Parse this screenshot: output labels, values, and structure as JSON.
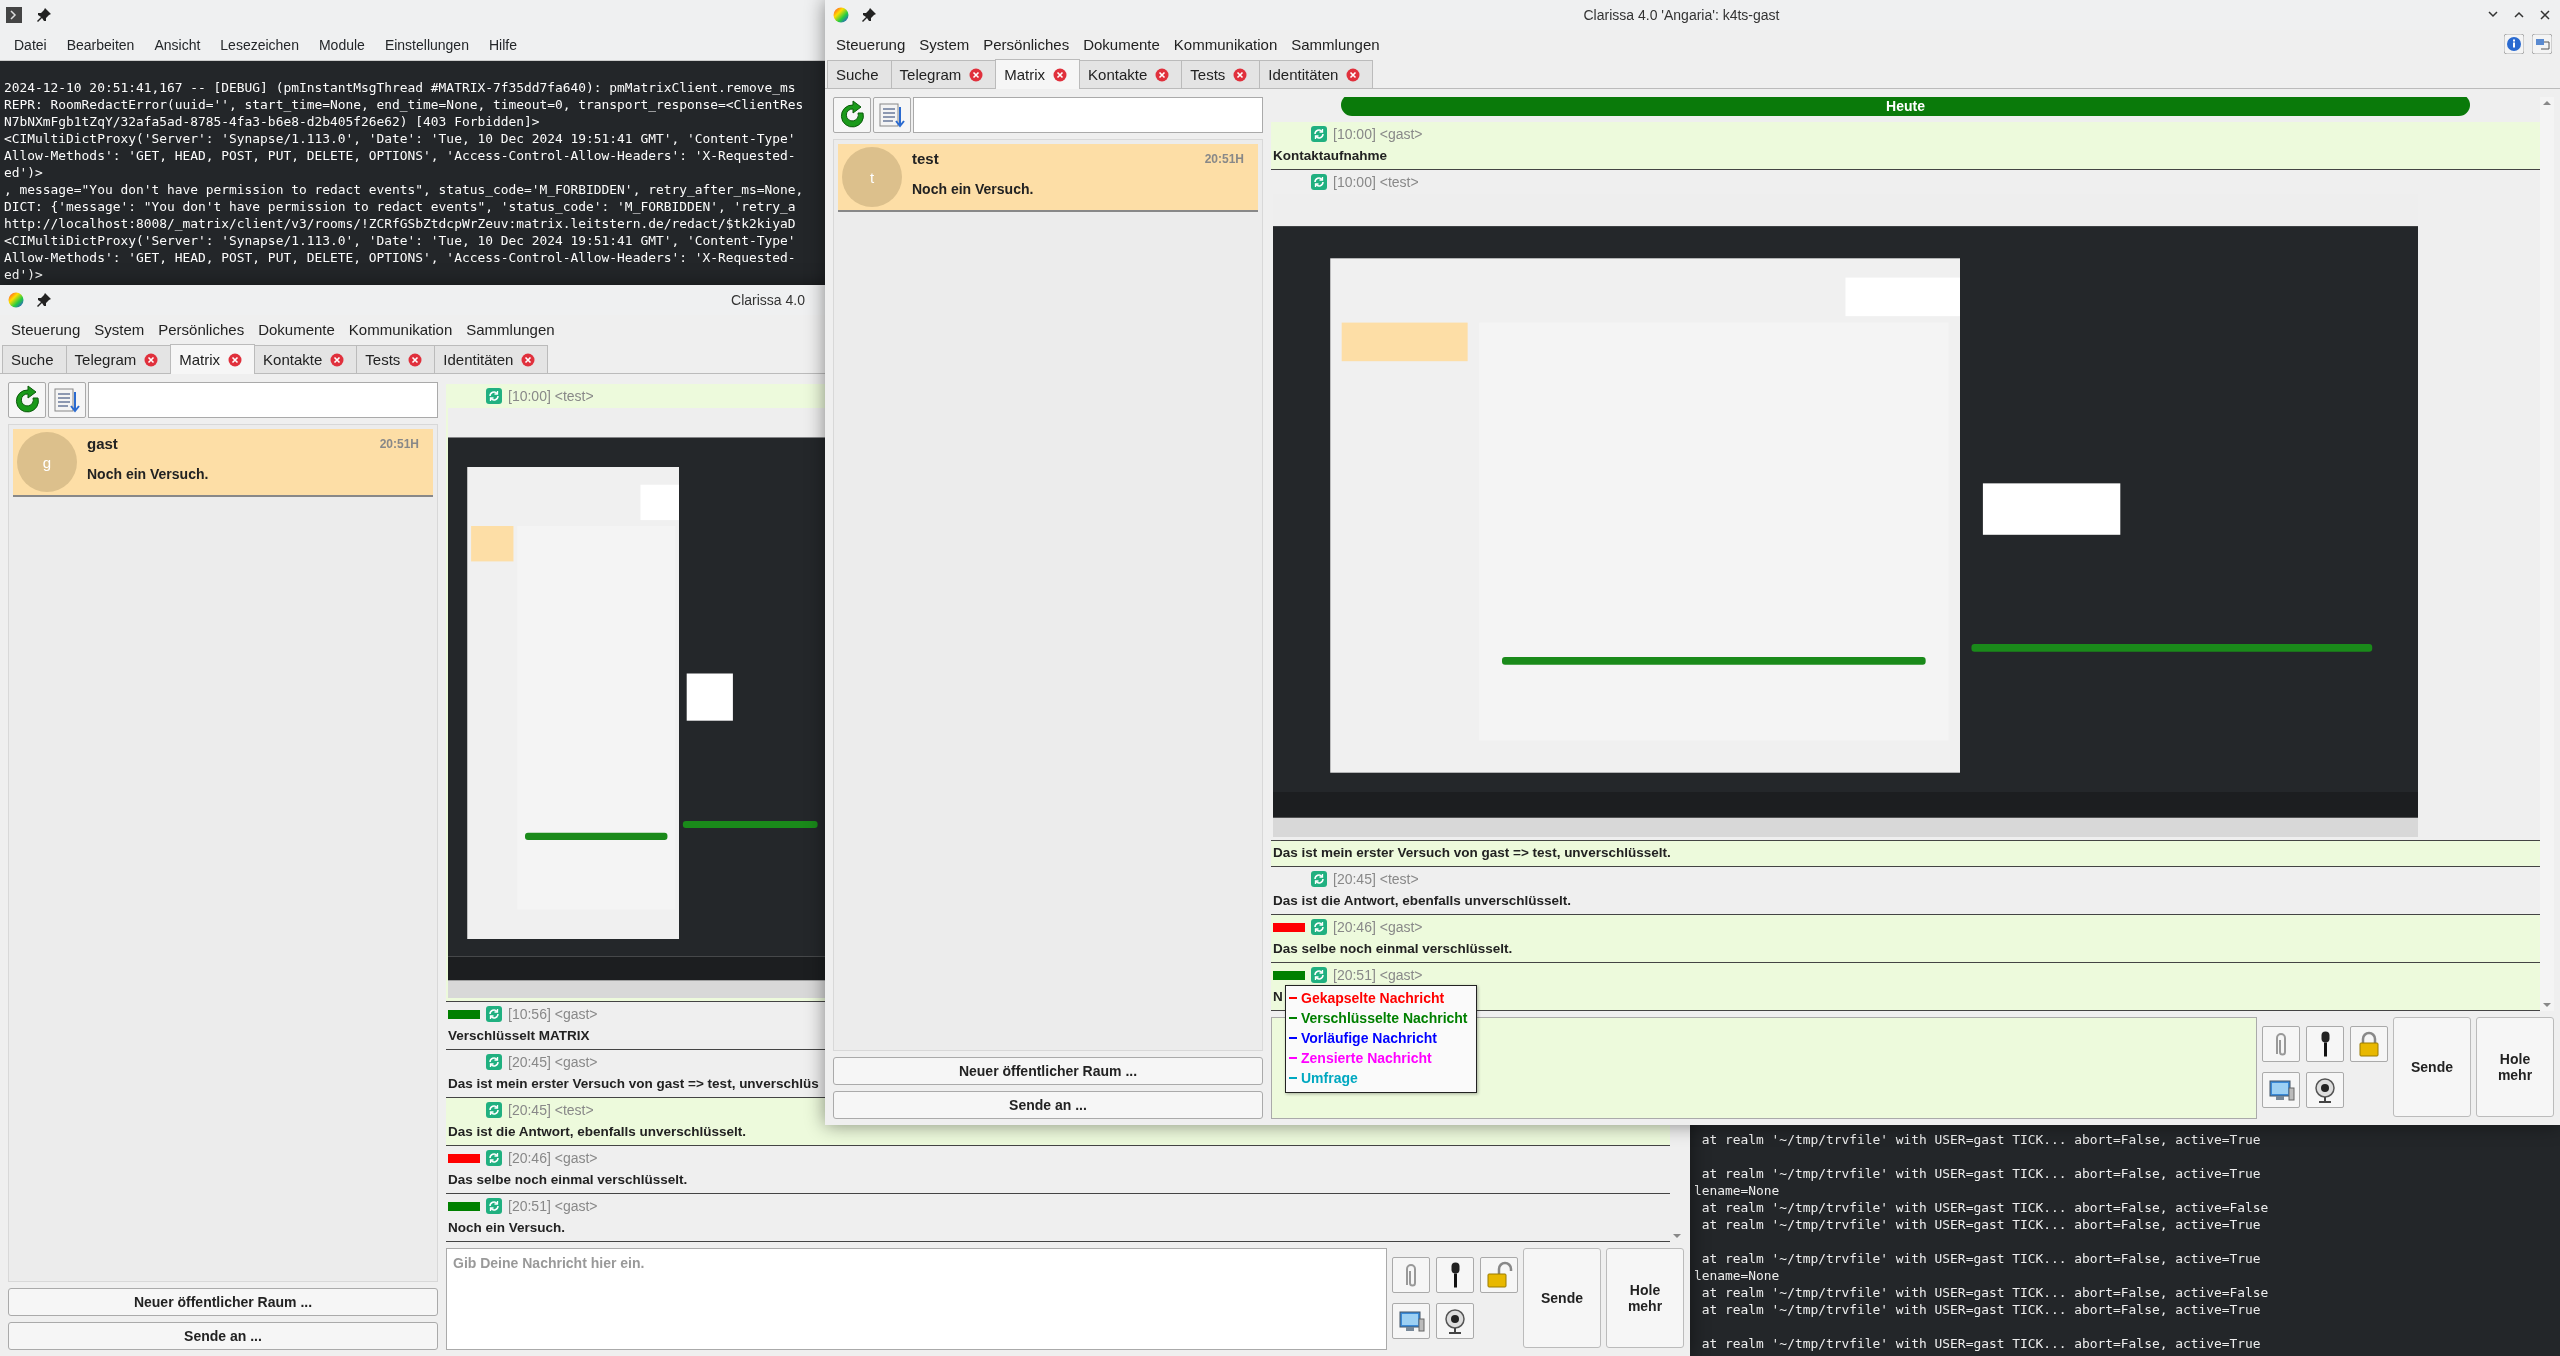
{
  "terminal": {
    "menu": [
      "Datei",
      "Bearbeiten",
      "Ansicht",
      "Lesezeichen",
      "Module",
      "Einstellungen",
      "Hilfe"
    ],
    "log_lines": [
      "2024-12-10 20:51:41,167 -- [DEBUG] (pmInstantMsgThread #MATRIX-7f35dd7fa640): pmMatrixClient.remove_ms",
      "REPR: RoomRedactError(uuid='', start_time=None, end_time=None, timeout=0, transport_response=<ClientRes",
      "N7bNXmFgb1tZqY/32afa5ad-8785-4fa3-b6e8-d2b405f26e62) [403 Forbidden]>",
      "<CIMultiDictProxy('Server': 'Synapse/1.113.0', 'Date': 'Tue, 10 Dec 2024 19:51:41 GMT', 'Content-Type'",
      "Allow-Methods': 'GET, HEAD, POST, PUT, DELETE, OPTIONS', 'Access-Control-Allow-Headers': 'X-Requested-",
      "ed')>",
      ", message=\"You don't have permission to redact events\", status_code='M_FORBIDDEN', retry_after_ms=None,",
      "DICT: {'message': \"You don't have permission to redact events\", 'status_code': 'M_FORBIDDEN', 'retry_a",
      "http://localhost:8008/_matrix/client/v3/rooms/!ZCRfGSbZtdcpWrZeuv:matrix.leitstern.de/redact/$tk2kiyaD",
      "<CIMultiDictProxy('Server': 'Synapse/1.113.0', 'Date': 'Tue, 10 Dec 2024 19:51:41 GMT', 'Content-Type'",
      "Allow-Methods': 'GET, HEAD, POST, PUT, DELETE, OPTIONS', 'Access-Control-Allow-Headers': 'X-Requested-",
      "ed')>"
    ],
    "tail_groups": [
      [
        " at realm '~/tmp/trvfile' with USER=gast TICK... abort=False, active=True"
      ],
      [
        " at realm '~/tmp/trvfile' with USER=gast TICK... abort=False, active=True",
        "lename=None",
        " at realm '~/tmp/trvfile' with USER=gast TICK... abort=False, active=False",
        " at realm '~/tmp/trvfile' with USER=gast TICK... abort=False, active=True"
      ],
      [
        " at realm '~/tmp/trvfile' with USER=gast TICK... abort=False, active=True",
        "lename=None",
        " at realm '~/tmp/trvfile' with USER=gast TICK... abort=False, active=False",
        " at realm '~/tmp/trvfile' with USER=gast TICK... abort=False, active=True"
      ],
      [
        " at realm '~/tmp/trvfile' with USER=gast TICK... abort=False, active=True"
      ]
    ]
  },
  "back_window": {
    "title": "Clarissa 4.0",
    "menu": [
      "Steuerung",
      "System",
      "Persönliches",
      "Dokumente",
      "Kommunikation",
      "Sammlungen"
    ],
    "tabs": [
      {
        "label": "Suche",
        "selected": false,
        "closable": false
      },
      {
        "label": "Telegram",
        "selected": false,
        "closable": true
      },
      {
        "label": "Matrix",
        "selected": true,
        "closable": true
      },
      {
        "label": "Kontakte",
        "selected": false,
        "closable": true
      },
      {
        "label": "Tests",
        "selected": false,
        "closable": true
      },
      {
        "label": "Identitäten",
        "selected": false,
        "closable": true
      }
    ],
    "rooms": [
      {
        "avatar": "g",
        "name": "gast",
        "time": "20:51H",
        "preview": "Noch ein Versuch.",
        "selected": true
      }
    ],
    "messages": [
      {
        "kind": "picture",
        "header": "[10:00] <test>",
        "highlighted": true
      },
      {
        "kind": "text",
        "header": "[10:56] <gast>",
        "text": "Verschlüsselt MATRIX",
        "color": "#008000",
        "highlighted": false
      },
      {
        "kind": "text",
        "header": "[20:45] <gast>",
        "text": "Das ist mein erster Versuch von gast => test, unverschlüs",
        "highlighted": false
      },
      {
        "kind": "text",
        "header": "[20:45] <test>",
        "text": "Das ist die Antwort, ebenfalls unverschlüsselt.",
        "highlighted": true
      },
      {
        "kind": "text",
        "header": "[20:46] <gast>",
        "text": "Das selbe noch einmal verschlüsselt.",
        "color": "#ff0000",
        "highlighted": false
      },
      {
        "kind": "text",
        "header": "[20:51] <gast>",
        "text": "Noch ein Versuch.",
        "color": "#008000",
        "highlighted": false
      }
    ],
    "input": {
      "placeholder": "Gib Deine Nachricht hier ein.",
      "highlighted": false
    },
    "locked": false,
    "buttons": [
      "Neuer öffentlicher Raum ...",
      "Sende an ..."
    ],
    "send": "Sende",
    "more": "Hole mehr"
  },
  "front_window": {
    "title": "Clarissa 4.0 'Angaria': k4ts-gast",
    "menu": [
      "Steuerung",
      "System",
      "Persönliches",
      "Dokumente",
      "Kommunikation",
      "Sammlungen"
    ],
    "tabs": [
      {
        "label": "Suche",
        "selected": false,
        "closable": false
      },
      {
        "label": "Telegram",
        "selected": false,
        "closable": true
      },
      {
        "label": "Matrix",
        "selected": true,
        "closable": true
      },
      {
        "label": "Kontakte",
        "selected": false,
        "closable": true
      },
      {
        "label": "Tests",
        "selected": false,
        "closable": true
      },
      {
        "label": "Identitäten",
        "selected": false,
        "closable": true
      }
    ],
    "rooms": [
      {
        "avatar": "t",
        "name": "test",
        "time": "20:51H",
        "preview": "Noch ein Versuch.",
        "selected": true
      }
    ],
    "day_separator": "Heute",
    "messages": [
      {
        "kind": "text",
        "header": "[10:00] <gast>",
        "text": "Kontaktaufnahme",
        "highlighted": true
      },
      {
        "kind": "picture",
        "header": "[10:00] <test>",
        "highlighted": false
      },
      {
        "kind": "text",
        "text": "Das ist mein erster Versuch von gast => test, unverschlüsselt.",
        "highlighted": true
      },
      {
        "kind": "text",
        "header": "[20:45] <test>",
        "text": "Das ist die Antwort, ebenfalls unverschlüsselt.",
        "highlighted": false
      },
      {
        "kind": "text",
        "header": "[20:46] <gast>",
        "text": "Das selbe noch einmal verschlüsselt.",
        "color": "#ff0000",
        "highlighted": true
      },
      {
        "kind": "text",
        "header": "[20:51] <gast>",
        "text": "N",
        "color": "#008000",
        "highlighted": true
      }
    ],
    "input": {
      "highlighted": true
    },
    "locked": true,
    "buttons": [
      "Neuer öffentlicher Raum ...",
      "Sende an ..."
    ],
    "send": "Sende",
    "more": "Hole mehr",
    "popup": [
      {
        "label": "Gekapselte Nachricht",
        "color": "#ff0000"
      },
      {
        "label": "Verschlüsselte Nachricht",
        "color": "#008000"
      },
      {
        "label": "Vorläufige Nachricht",
        "color": "#0000ff"
      },
      {
        "label": "Zensierte Nachricht",
        "color": "#ff00ff"
      },
      {
        "label": "Umfrage",
        "color": "#00a8c0"
      }
    ]
  }
}
